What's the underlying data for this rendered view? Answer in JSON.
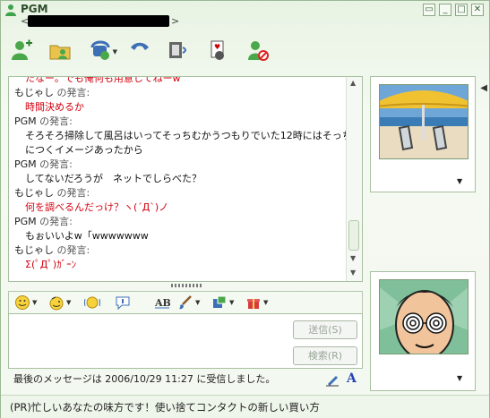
{
  "window": {
    "title": "PGM",
    "subtitle_left": "<",
    "subtitle_right": ">",
    "controls": [
      "▭",
      "_",
      "□",
      "✕"
    ]
  },
  "toolbar": {
    "items": [
      {
        "name": "invite-icon"
      },
      {
        "name": "send-files-icon"
      },
      {
        "name": "voice-icon"
      },
      {
        "name": "phone-icon"
      },
      {
        "name": "video-icon"
      },
      {
        "name": "games-icon"
      },
      {
        "name": "block-icon"
      }
    ]
  },
  "conversation": [
    {
      "type": "msg",
      "color": "red",
      "text": "たなー。でも俺何も用意してねーw"
    },
    {
      "type": "who",
      "name": "もじゃし",
      "label": "の発言:"
    },
    {
      "type": "msg",
      "color": "red",
      "text": "時間決めるか"
    },
    {
      "type": "who",
      "name": "PGM",
      "label": "の発言:"
    },
    {
      "type": "msg",
      "color": "black",
      "text": "そろそろ掃除して風呂はいってそっちむかうつもりでいた12時にはそっち"
    },
    {
      "type": "msg",
      "color": "black",
      "text": "につくイメージあったから"
    },
    {
      "type": "who",
      "name": "PGM",
      "label": "の発言:"
    },
    {
      "type": "msg",
      "color": "black",
      "text": "してないだろうが　ネットでしらべた？"
    },
    {
      "type": "who",
      "name": "もじゃし",
      "label": "の発言:"
    },
    {
      "type": "msg",
      "color": "red",
      "text": "何を調べるんだっけ？ヽ(´Д`)ノ"
    },
    {
      "type": "who",
      "name": "PGM",
      "label": "の発言:"
    },
    {
      "type": "msg",
      "color": "black",
      "text": "もぉいいよw「wwwwwww"
    },
    {
      "type": "who",
      "name": "もじゃし",
      "label": "の発言:"
    },
    {
      "type": "msg",
      "color": "red",
      "text": "Σ(ﾟДﾟ)ｶﾞｰﾝ"
    }
  ],
  "composer": {
    "value": "",
    "send_label": "送信(S)",
    "search_label": "検索(R)"
  },
  "status": {
    "text": "最後のメッセージは 2006/10/29 11:27 に受信しました。"
  },
  "ad": {
    "text": "(PR)忙しいあなたの味方です！使い捨てコンタクトの新しい買い方"
  },
  "font_button": "A",
  "colors": {
    "accent": "#d2000f",
    "frame": "#a7c0a0",
    "background": "#eef5ea"
  }
}
